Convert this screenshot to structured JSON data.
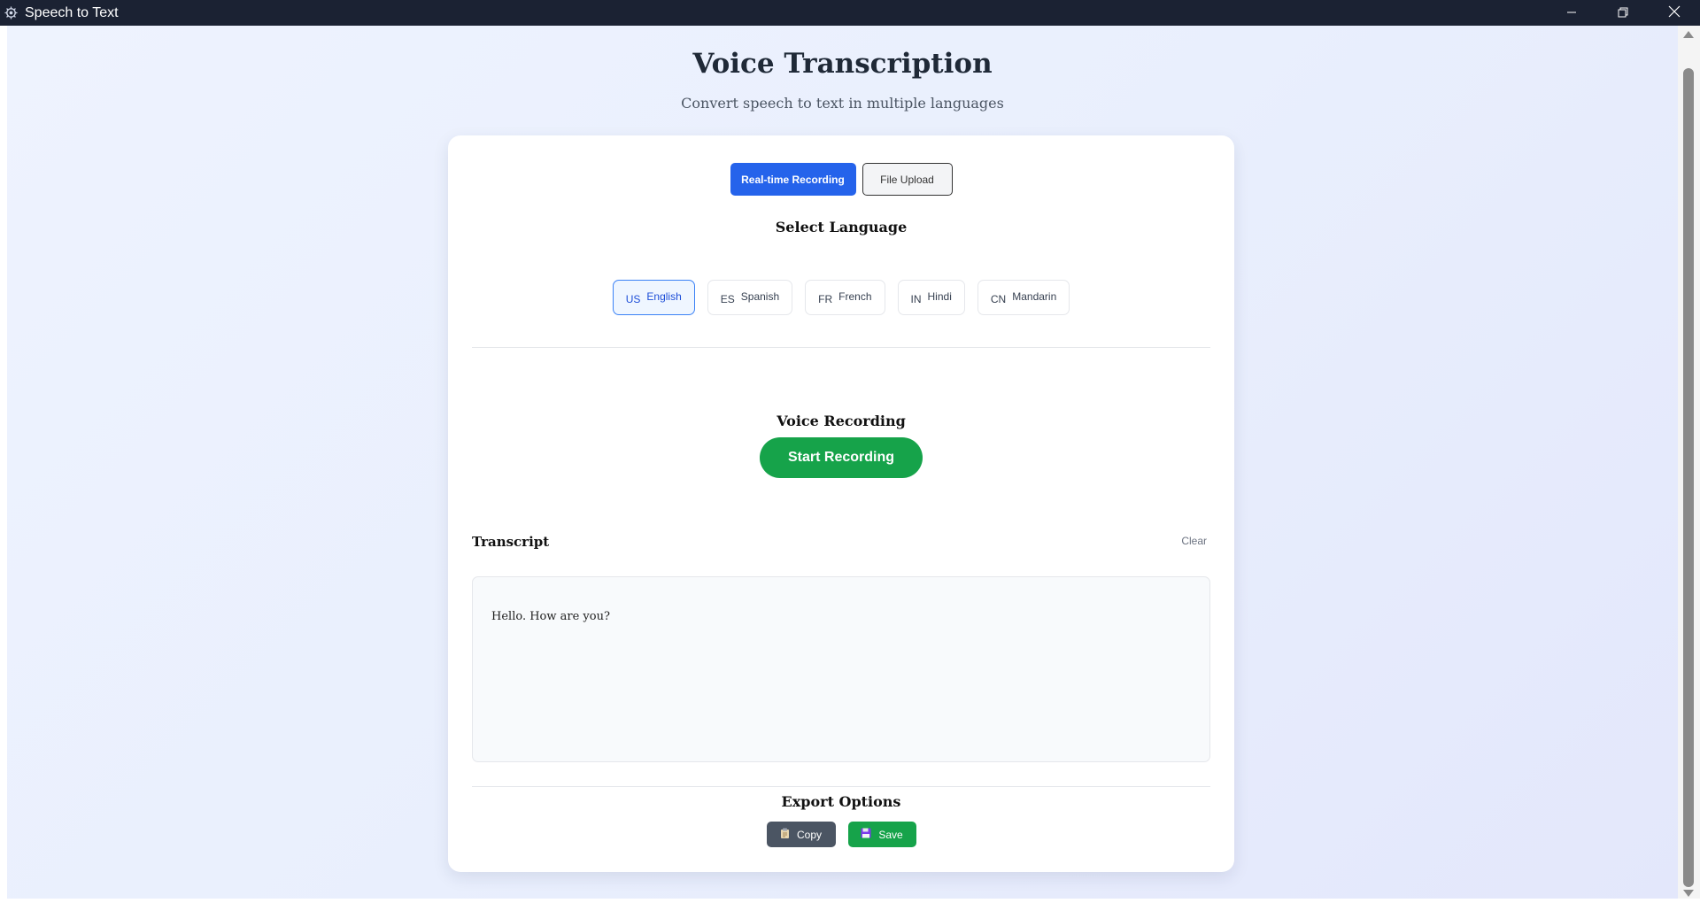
{
  "window": {
    "title": "Speech to Text",
    "icon": "gear-icon",
    "controls": [
      "minimize-icon",
      "restore-icon",
      "close-icon"
    ]
  },
  "header": {
    "title": "Voice Transcription",
    "subtitle": "Convert speech to text in multiple languages"
  },
  "mode_tabs": [
    {
      "label": "Real-time Recording",
      "active": true
    },
    {
      "label": "File Upload",
      "active": false
    }
  ],
  "language_section": {
    "heading": "Select Language",
    "options": [
      {
        "code": "US",
        "label": "English",
        "selected": true
      },
      {
        "code": "ES",
        "label": "Spanish",
        "selected": false
      },
      {
        "code": "FR",
        "label": "French",
        "selected": false
      },
      {
        "code": "IN",
        "label": "Hindi",
        "selected": false
      },
      {
        "code": "CN",
        "label": "Mandarin",
        "selected": false
      }
    ]
  },
  "recording": {
    "heading": "Voice Recording",
    "button_label": "Start Recording"
  },
  "transcript": {
    "label": "Transcript",
    "clear_label": "Clear",
    "text": "Hello. How are you?"
  },
  "export": {
    "heading": "Export Options",
    "copy_label": "Copy",
    "copy_icon": "clipboard-icon",
    "save_label": "Save",
    "save_icon": "floppy-disk-icon"
  },
  "colors": {
    "accent": "#2563eb",
    "success": "#16a34a",
    "titlebar": "#1b2233"
  }
}
